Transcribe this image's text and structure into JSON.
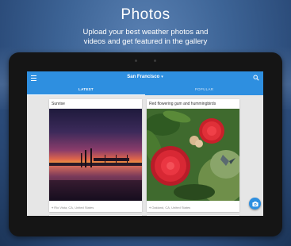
{
  "promo": {
    "title": "Photos",
    "subtitle_line1": "Upload your best weather photos and",
    "subtitle_line2": "videos and get featured in the gallery"
  },
  "appbar": {
    "menu_icon": "hamburger-menu-icon",
    "location": "San Francisco",
    "location_dropdown_icon": "caret-down-icon",
    "search_icon": "search-icon",
    "color": "#2e8fe0"
  },
  "tabs": [
    {
      "label": "LATEST",
      "selected": true
    },
    {
      "label": "POPULAR",
      "selected": false
    }
  ],
  "photos": [
    {
      "title": "Sunrise",
      "location": "Rio Vista, CA, United States",
      "scene": "sunset-over-water"
    },
    {
      "title": "Red flowering gum and hummingbirds",
      "location": "Oakland, CA, United States",
      "scene": "red-flowers-with-hummingbird"
    }
  ],
  "fab": {
    "icon": "camera-icon"
  }
}
